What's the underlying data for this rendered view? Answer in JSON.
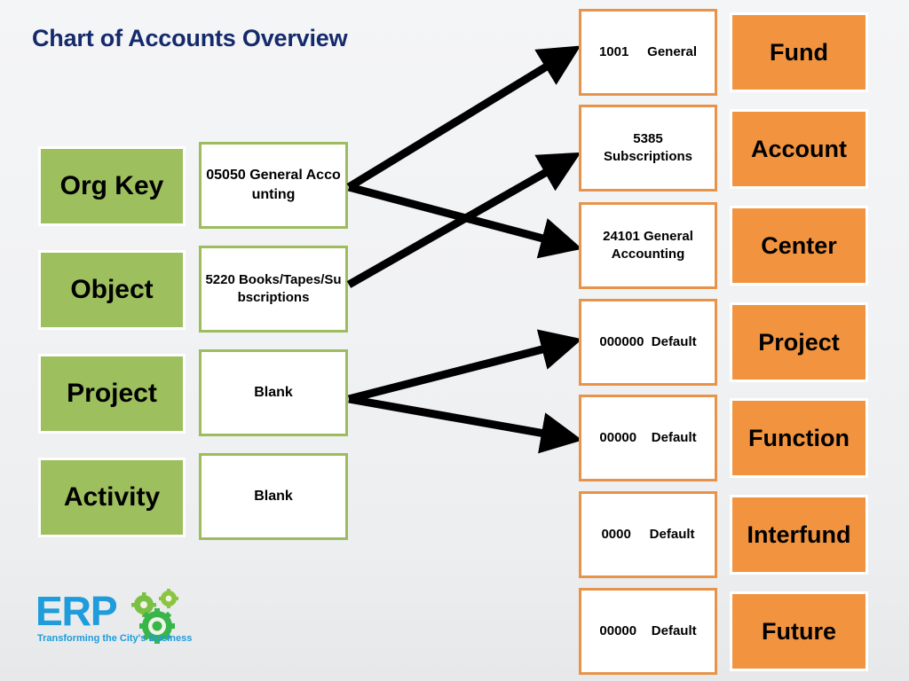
{
  "page_title": "Chart of Accounts Overview",
  "colors": {
    "title": "#142a6b",
    "segment_label_fill": "#9dbf5d",
    "segment_value_border": "#9cbc5e",
    "element_label_fill": "#f2943f",
    "element_value_border": "#e7944a",
    "arrow": "#000000",
    "logo_blue": "#1f9cdb",
    "logo_green": "#7ac143",
    "background": "#f1f2f4"
  },
  "left_column": {
    "segments": [
      {
        "label": "Org Key",
        "value": "05050 General Accounting"
      },
      {
        "label": "Object",
        "value": "5220 Books/Tapes/Subscriptions"
      },
      {
        "label": "Project",
        "value": "Blank"
      },
      {
        "label": "Activity",
        "value": "Blank"
      }
    ]
  },
  "left_value_lines": {
    "org_key_line1": "05050 General",
    "org_key_line2": "Accounting",
    "object_line1": "5220",
    "object_line2": "Books/Tapes/Subscriptions",
    "project_value": "Blank",
    "activity_value": "Blank"
  },
  "right_column": {
    "elements": [
      {
        "value": "1001     General",
        "label": "Fund"
      },
      {
        "value": "5385\nSubscriptions",
        "label": "Account"
      },
      {
        "value": "24101 General\nAccounting",
        "label": "Center"
      },
      {
        "value": "000000  Default",
        "label": "Project"
      },
      {
        "value": "00000    Default",
        "label": "Function"
      },
      {
        "value": "0000     Default",
        "label": "Interfund"
      },
      {
        "value": "00000    Default",
        "label": "Future"
      }
    ]
  },
  "mappings": [
    {
      "from": "Org Key",
      "to": "Fund"
    },
    {
      "from": "Org Key",
      "to": "Center"
    },
    {
      "from": "Object",
      "to": "Account"
    },
    {
      "from": "Project",
      "to": "Project"
    },
    {
      "from": "Project",
      "to": "Function"
    }
  ],
  "logo": {
    "wordmark": "ERP",
    "tagline": "Transforming the City's Business"
  }
}
